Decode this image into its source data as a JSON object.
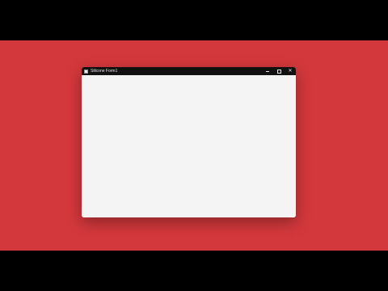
{
  "window": {
    "title": "Silicone Form1",
    "controls": {
      "minimize_icon": "minimize-icon",
      "maximize_icon": "maximize-icon",
      "close_icon": "close-icon"
    }
  },
  "colors": {
    "background": "#d3383c",
    "titlebar": "#111111",
    "client": "#f4f4f4"
  }
}
